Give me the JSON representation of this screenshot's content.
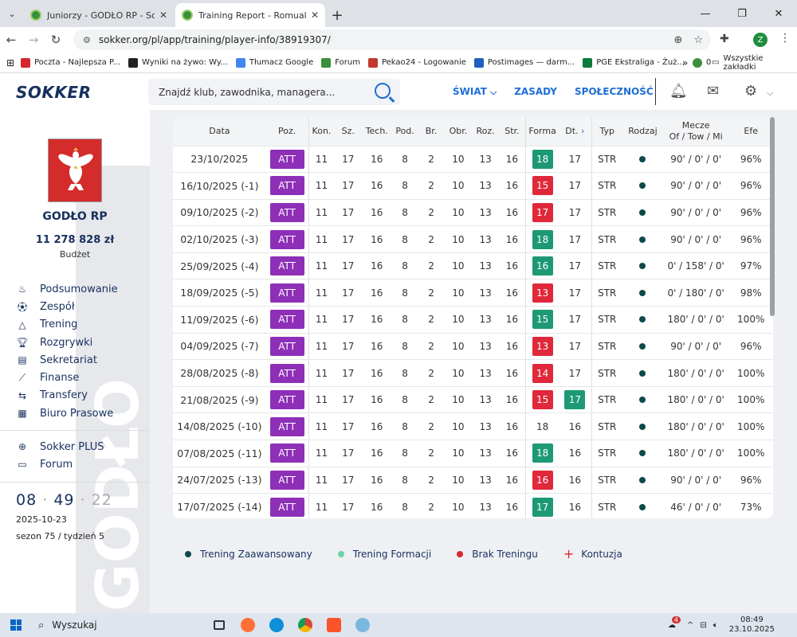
{
  "browser": {
    "tabs": [
      {
        "title": "Juniorzy - GODŁO RP - Sokker M",
        "active": false
      },
      {
        "title": "Training Report - Romuald Waje",
        "active": true
      }
    ],
    "url": "sokker.org/pl/app/training/player-info/38919307/",
    "bookmarks": [
      "Poczta - Najlepsza P...",
      "Wyniki na żywo: Wy...",
      "Tłumacz Google",
      "Forum",
      "Pekao24 - Logowanie",
      "Postimages — darm...",
      "PGE Ekstraliga - Żuż...",
      "0"
    ],
    "all_bookmarks": "Wszystkie zakładki",
    "profile_initial": "Z"
  },
  "header": {
    "logo": "SOKKER",
    "search_placeholder": "Znajdź klub, zawodnika, managera...",
    "nav": [
      "ŚWIAT",
      "ZASADY",
      "SPOŁECZNOŚĆ"
    ]
  },
  "sidebar": {
    "club_name": "GODŁO RP",
    "budget": "11 278 828 zł",
    "budget_label": "Budżet",
    "menu": [
      "Podsumowanie",
      "Zespół",
      "Trening",
      "Rozgrywki",
      "Sekretariat",
      "Finanse",
      "Transfery",
      "Biuro Prasowe"
    ],
    "menu2": [
      "Sokker PLUS",
      "Forum"
    ],
    "clock": {
      "h": "08",
      "m": "49",
      "s": "22"
    },
    "date": "2025-10-23",
    "season": "sezon 75 / tydzień 5",
    "watermark": "GODŁO"
  },
  "table": {
    "headers": {
      "date": "Data",
      "pos": "Poz.",
      "kon": "Kon.",
      "sz": "Sz.",
      "tech": "Tech.",
      "pod": "Pod.",
      "br": "Br.",
      "obr": "Obr.",
      "roz": "Roz.",
      "str": "Str.",
      "forma": "Forma",
      "dt": "Dt.",
      "typ": "Typ",
      "rodzaj": "Rodzaj",
      "mecze1": "Mecze",
      "mecze2": "Of / Tow / Mi",
      "efe": "Efe"
    },
    "rows": [
      {
        "date": "23/10/2025",
        "pos": "ATT",
        "kon": "11",
        "sz": "17",
        "tech": "16",
        "pod": "8",
        "br": "2",
        "obr": "10",
        "roz": "13",
        "str": "16",
        "forma": "18",
        "forma_color": "g",
        "dt": "17",
        "dt_color": "",
        "typ": "STR",
        "mecze": "90' / 0' / 0'",
        "efe": "96%"
      },
      {
        "date": "16/10/2025 (-1)",
        "pos": "ATT",
        "kon": "11",
        "sz": "17",
        "tech": "16",
        "pod": "8",
        "br": "2",
        "obr": "10",
        "roz": "13",
        "str": "16",
        "forma": "15",
        "forma_color": "r",
        "dt": "17",
        "dt_color": "",
        "typ": "STR",
        "mecze": "90' / 0' / 0'",
        "efe": "96%"
      },
      {
        "date": "09/10/2025 (-2)",
        "pos": "ATT",
        "kon": "11",
        "sz": "17",
        "tech": "16",
        "pod": "8",
        "br": "2",
        "obr": "10",
        "roz": "13",
        "str": "16",
        "forma": "17",
        "forma_color": "r",
        "dt": "17",
        "dt_color": "",
        "typ": "STR",
        "mecze": "90' / 0' / 0'",
        "efe": "96%"
      },
      {
        "date": "02/10/2025 (-3)",
        "pos": "ATT",
        "kon": "11",
        "sz": "17",
        "tech": "16",
        "pod": "8",
        "br": "2",
        "obr": "10",
        "roz": "13",
        "str": "16",
        "forma": "18",
        "forma_color": "g",
        "dt": "17",
        "dt_color": "",
        "typ": "STR",
        "mecze": "90' / 0' / 0'",
        "efe": "96%"
      },
      {
        "date": "25/09/2025 (-4)",
        "pos": "ATT",
        "kon": "11",
        "sz": "17",
        "tech": "16",
        "pod": "8",
        "br": "2",
        "obr": "10",
        "roz": "13",
        "str": "16",
        "forma": "16",
        "forma_color": "g",
        "dt": "17",
        "dt_color": "",
        "typ": "STR",
        "mecze": "0' / 158' / 0'",
        "efe": "97%"
      },
      {
        "date": "18/09/2025 (-5)",
        "pos": "ATT",
        "kon": "11",
        "sz": "17",
        "tech": "16",
        "pod": "8",
        "br": "2",
        "obr": "10",
        "roz": "13",
        "str": "16",
        "forma": "13",
        "forma_color": "r",
        "dt": "17",
        "dt_color": "",
        "typ": "STR",
        "mecze": "0' / 180' / 0'",
        "efe": "98%"
      },
      {
        "date": "11/09/2025 (-6)",
        "pos": "ATT",
        "kon": "11",
        "sz": "17",
        "tech": "16",
        "pod": "8",
        "br": "2",
        "obr": "10",
        "roz": "13",
        "str": "16",
        "forma": "15",
        "forma_color": "g",
        "dt": "17",
        "dt_color": "",
        "typ": "STR",
        "mecze": "180' / 0' / 0'",
        "efe": "100%"
      },
      {
        "date": "04/09/2025 (-7)",
        "pos": "ATT",
        "kon": "11",
        "sz": "17",
        "tech": "16",
        "pod": "8",
        "br": "2",
        "obr": "10",
        "roz": "13",
        "str": "16",
        "forma": "13",
        "forma_color": "r",
        "dt": "17",
        "dt_color": "",
        "typ": "STR",
        "mecze": "90' / 0' / 0'",
        "efe": "96%"
      },
      {
        "date": "28/08/2025 (-8)",
        "pos": "ATT",
        "kon": "11",
        "sz": "17",
        "tech": "16",
        "pod": "8",
        "br": "2",
        "obr": "10",
        "roz": "13",
        "str": "16",
        "forma": "14",
        "forma_color": "r",
        "dt": "17",
        "dt_color": "",
        "typ": "STR",
        "mecze": "180' / 0' / 0'",
        "efe": "100%"
      },
      {
        "date": "21/08/2025 (-9)",
        "pos": "ATT",
        "kon": "11",
        "sz": "17",
        "tech": "16",
        "pod": "8",
        "br": "2",
        "obr": "10",
        "roz": "13",
        "str": "16",
        "forma": "15",
        "forma_color": "r",
        "dt": "17",
        "dt_color": "g",
        "typ": "STR",
        "mecze": "180' / 0' / 0'",
        "efe": "100%"
      },
      {
        "date": "14/08/2025 (-10)",
        "pos": "ATT",
        "kon": "11",
        "sz": "17",
        "tech": "16",
        "pod": "8",
        "br": "2",
        "obr": "10",
        "roz": "13",
        "str": "16",
        "forma": "18",
        "forma_color": "",
        "dt": "16",
        "dt_color": "",
        "typ": "STR",
        "mecze": "180' / 0' / 0'",
        "efe": "100%"
      },
      {
        "date": "07/08/2025 (-11)",
        "pos": "ATT",
        "kon": "11",
        "sz": "17",
        "tech": "16",
        "pod": "8",
        "br": "2",
        "obr": "10",
        "roz": "13",
        "str": "16",
        "forma": "18",
        "forma_color": "g",
        "dt": "16",
        "dt_color": "",
        "typ": "STR",
        "mecze": "180' / 0' / 0'",
        "efe": "100%"
      },
      {
        "date": "24/07/2025 (-13)",
        "pos": "ATT",
        "kon": "11",
        "sz": "17",
        "tech": "16",
        "pod": "8",
        "br": "2",
        "obr": "10",
        "roz": "13",
        "str": "16",
        "forma": "16",
        "forma_color": "r",
        "dt": "16",
        "dt_color": "",
        "typ": "STR",
        "mecze": "90' / 0' / 0'",
        "efe": "96%"
      },
      {
        "date": "17/07/2025 (-14)",
        "pos": "ATT",
        "kon": "11",
        "sz": "17",
        "tech": "16",
        "pod": "8",
        "br": "2",
        "obr": "10",
        "roz": "13",
        "str": "16",
        "forma": "17",
        "forma_color": "g",
        "dt": "16",
        "dt_color": "",
        "typ": "STR",
        "mecze": "46' / 0' / 0'",
        "efe": "73%"
      }
    ]
  },
  "legend": [
    {
      "label": "Trening Zaawansowany",
      "color": "#0d4a4a"
    },
    {
      "label": "Trening Formacji",
      "color": "#6fd1a8"
    },
    {
      "label": "Brak Treningu",
      "color": "#d9262f"
    },
    {
      "label": "Kontuzja",
      "color": "#d9262f",
      "symbol": "+"
    }
  ],
  "colors": {
    "att": "#8e2fb8",
    "green": "#1e9975",
    "red": "#e0283a",
    "brand": "#17305e",
    "link": "#1f6fd6"
  },
  "taskbar": {
    "search": "Wyszukaj",
    "time": "08:49",
    "date": "23.10.2025",
    "notif": "4"
  }
}
